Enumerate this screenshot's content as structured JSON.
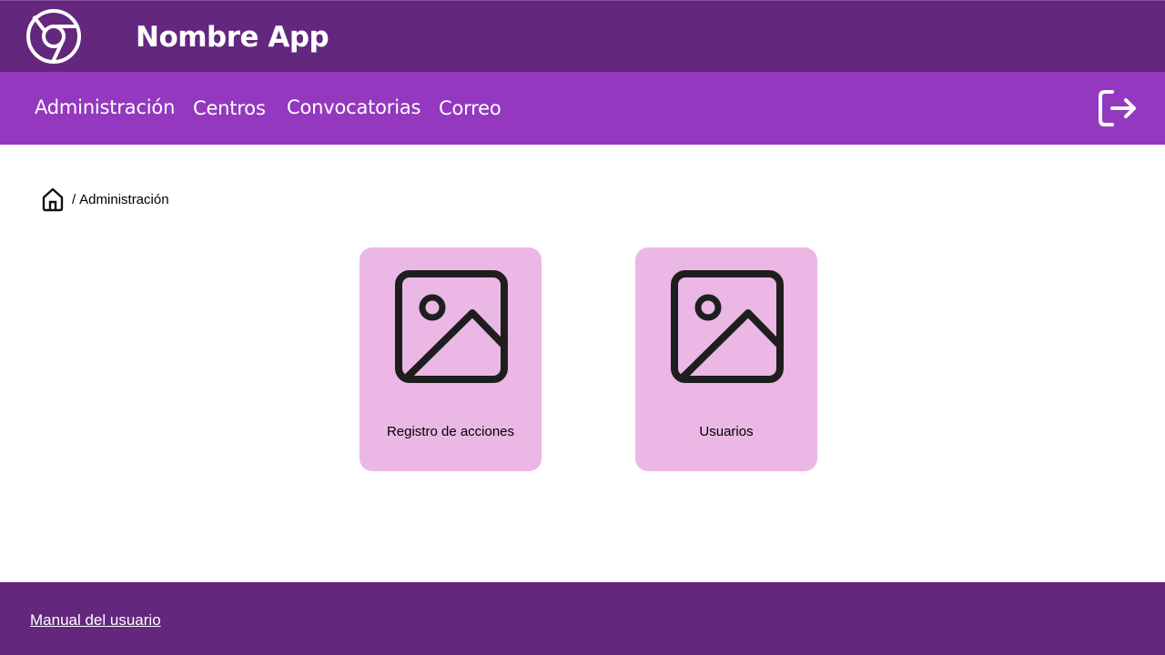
{
  "header": {
    "title": "Nombre App",
    "logo_icon": "chrome-logo-icon"
  },
  "nav": {
    "items": [
      {
        "label": "Administración"
      },
      {
        "label": "Centros"
      },
      {
        "label": "Convocatorias"
      },
      {
        "label": "Correo"
      }
    ],
    "logout_icon": "logout-icon"
  },
  "breadcrumb": {
    "home_icon": "home-icon",
    "separator": "/",
    "current": "Administración"
  },
  "cards": [
    {
      "label": "Registro de acciones",
      "icon": "image-placeholder-icon"
    },
    {
      "label": "Usuarios",
      "icon": "image-placeholder-icon"
    }
  ],
  "footer": {
    "link_label": "Manual del usuario"
  },
  "colors": {
    "header_bg": "#64277e",
    "nav_bg": "#9438bf",
    "card_bg": "#ebb7e5",
    "footer_bg": "#64277e"
  }
}
